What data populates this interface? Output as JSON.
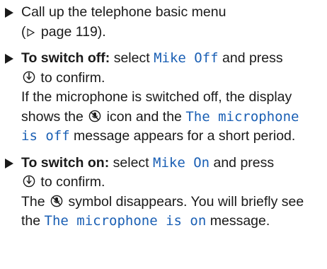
{
  "items": [
    {
      "text_before_ref": "Call up the telephone basic menu",
      "ref_open": "(",
      "ref_text": " page 119).",
      "bullet_icon": "triangle-bullet-icon"
    },
    {
      "label": "To switch off:",
      "select": " select ",
      "option": "Mike Off",
      "and_press": " and press",
      "to_confirm": " to confirm.",
      "p2_before": "If the microphone is switched off, the display shows the ",
      "p2_after": " icon and the ",
      "message": "The microphone is off",
      "p2_end": " message appears for a short period.",
      "confirm_icon": "confirm-knob-icon",
      "mic_off_icon": "microphone-off-icon"
    },
    {
      "label": "To switch on:",
      "select": " select ",
      "option": "Mike On",
      "and_press": " and press",
      "to_confirm": " to confirm.",
      "p2_before": "The ",
      "p2_after": " symbol disappears. You will briefly see the ",
      "message": "The microphone is on",
      "p2_end": " message.",
      "confirm_icon": "confirm-knob-icon",
      "mic_off_icon": "microphone-off-icon"
    }
  ],
  "colors": {
    "text": "#1a1a1a",
    "display_text": "#1a5fb4"
  }
}
